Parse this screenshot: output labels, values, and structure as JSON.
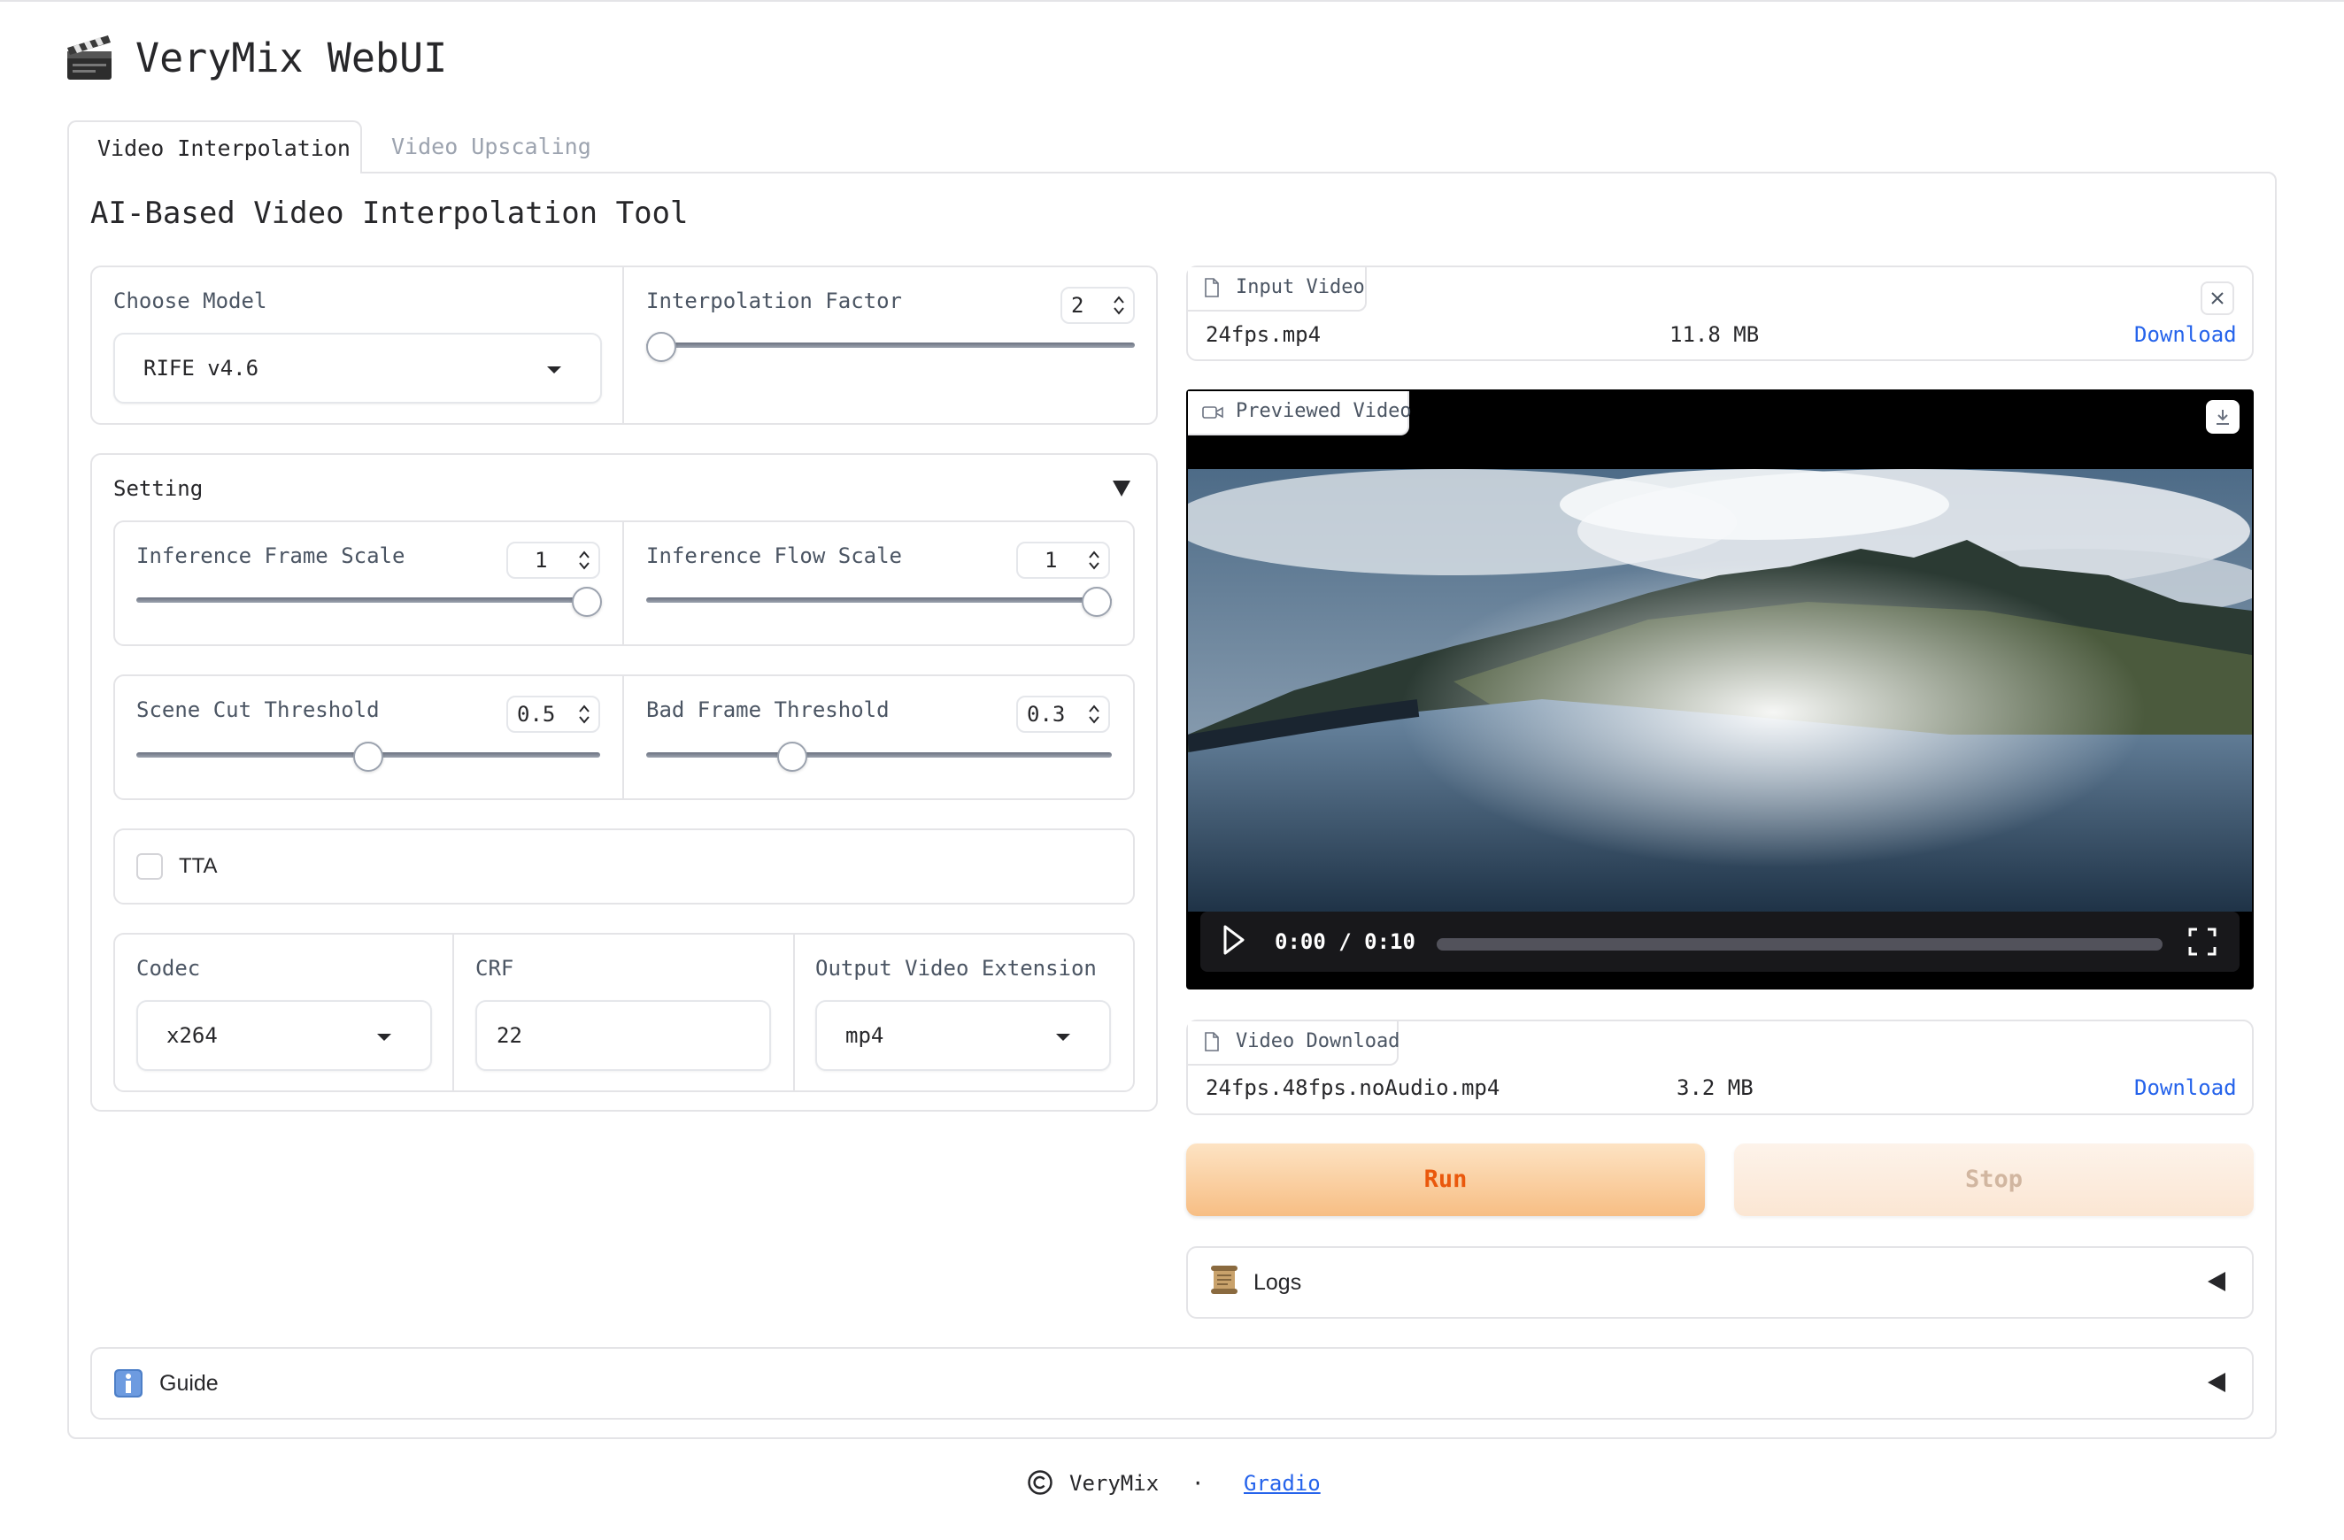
{
  "app": {
    "title": "VeryMix WebUI",
    "title_icon": "clapperboard-icon"
  },
  "tabs": [
    {
      "label": "Video Interpolation",
      "active": true
    },
    {
      "label": "Video Upscaling",
      "active": false
    }
  ],
  "main": {
    "subtitle": "AI-Based Video Interpolation Tool"
  },
  "model": {
    "label": "Choose Model",
    "value": "RIFE v4.6"
  },
  "interpolation": {
    "label": "Interpolation Factor",
    "value": "2",
    "slider_fraction": 0.0
  },
  "setting": {
    "label": "Setting",
    "frame_scale": {
      "label": "Inference Frame Scale",
      "value": "1",
      "slider_fraction": 1.0
    },
    "flow_scale": {
      "label": "Inference Flow Scale",
      "value": "1",
      "slider_fraction": 1.0
    },
    "scene_cut": {
      "label": "Scene Cut Threshold",
      "value": "0.5",
      "slider_fraction": 0.5
    },
    "bad_frame": {
      "label": "Bad Frame Threshold",
      "value": "0.3",
      "slider_fraction": 0.3
    },
    "tta": {
      "label": "TTA",
      "checked": false
    },
    "codec": {
      "label": "Codec",
      "value": "x264"
    },
    "crf": {
      "label": "CRF",
      "value": "22"
    },
    "extension": {
      "label": "Output Video Extension",
      "value": "mp4"
    }
  },
  "input_video": {
    "label": "Input Video",
    "filename": "24fps.mp4",
    "size": "11.8 MB",
    "download": "Download"
  },
  "preview": {
    "label": "Previewed Video",
    "time": "0:00 / 0:10"
  },
  "video_download": {
    "label": "Video Download",
    "filename": "24fps.48fps.noAudio.mp4",
    "size": "3.2 MB",
    "download": "Download"
  },
  "buttons": {
    "run": "Run",
    "stop": "Stop"
  },
  "logs": {
    "label": "Logs",
    "icon": "scroll-icon"
  },
  "guide": {
    "label": "Guide",
    "icon": "info-icon"
  },
  "footer": {
    "brand": "VeryMix",
    "separator": "·",
    "link": "Gradio"
  },
  "colors": {
    "run_text": "#ea580c",
    "stop_text": "#d1b6a0",
    "link": "#2563eb"
  }
}
